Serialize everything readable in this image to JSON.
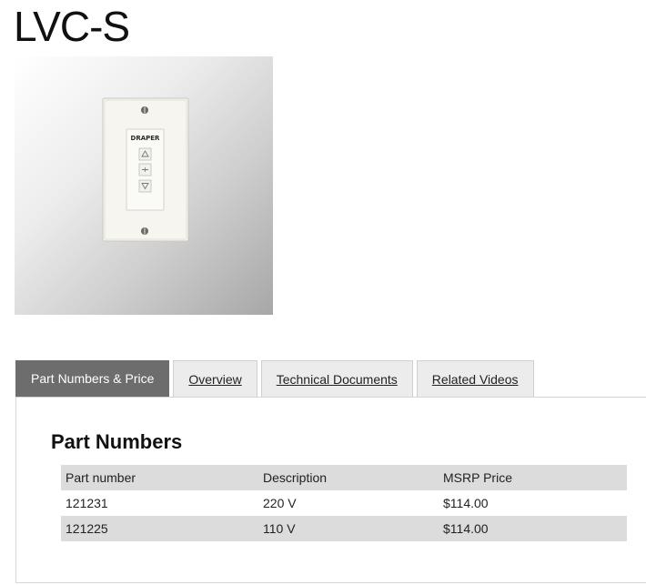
{
  "page": {
    "title": "LVC-S"
  },
  "product_image": {
    "brand_text": "DRAPER",
    "icons": [
      "up-arrow-icon",
      "stop-icon",
      "down-arrow-icon"
    ]
  },
  "tabs": [
    {
      "label": "Part Numbers & Price",
      "active": true
    },
    {
      "label": "Overview",
      "active": false
    },
    {
      "label": "Technical Documents",
      "active": false
    },
    {
      "label": "Related Videos",
      "active": false
    }
  ],
  "part_numbers": {
    "title": "Part Numbers",
    "columns": [
      "Part number",
      "Description",
      "MSRP Price"
    ],
    "rows": [
      [
        "121231",
        "220 V",
        "$114.00"
      ],
      [
        "121225",
        "110 V",
        "$114.00"
      ]
    ]
  },
  "colors": {
    "active_tab": "#6d6d6d",
    "row_shade": "#dcdcdc"
  }
}
